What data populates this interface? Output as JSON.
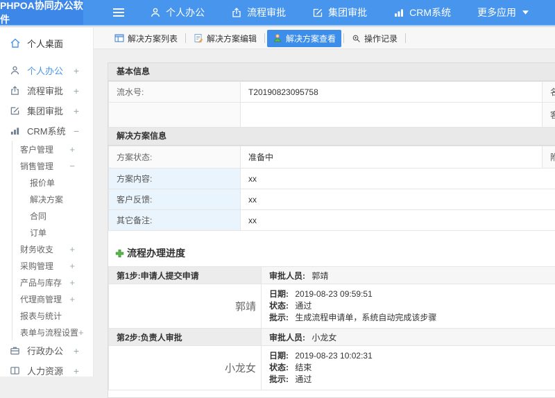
{
  "topbar": {
    "logo": "PHPOA协同办公软件",
    "nav": [
      {
        "label": "个人办公"
      },
      {
        "label": "流程审批"
      },
      {
        "label": "集团审批"
      },
      {
        "label": "CRM系统"
      },
      {
        "label": "更多应用"
      }
    ]
  },
  "sidebar": {
    "desktop": "个人桌面",
    "items": [
      {
        "label": "个人办公",
        "toggle": "+"
      },
      {
        "label": "流程审批",
        "toggle": "+"
      },
      {
        "label": "集团审批",
        "toggle": "+"
      },
      {
        "label": "CRM系统",
        "toggle": "−"
      },
      {
        "label": "客户管理",
        "toggle": "+"
      },
      {
        "label": "销售管理",
        "toggle": "−"
      },
      {
        "label": "报价单",
        "toggle": ""
      },
      {
        "label": "解决方案",
        "toggle": ""
      },
      {
        "label": "合同",
        "toggle": ""
      },
      {
        "label": "订单",
        "toggle": ""
      },
      {
        "label": "财务收支",
        "toggle": "+"
      },
      {
        "label": "采购管理",
        "toggle": "+"
      },
      {
        "label": "产品与库存",
        "toggle": "+"
      },
      {
        "label": "代理商管理",
        "toggle": "+"
      },
      {
        "label": "报表与统计",
        "toggle": ""
      },
      {
        "label": "表单与流程设置",
        "toggle": "+"
      },
      {
        "label": "行政办公",
        "toggle": "+"
      },
      {
        "label": "人力资源",
        "toggle": "+"
      }
    ]
  },
  "tabs": [
    {
      "label": "解决方案列表"
    },
    {
      "label": "解决方案编辑"
    },
    {
      "label": "解决方案查看"
    },
    {
      "label": "操作记录"
    }
  ],
  "basic": {
    "title": "基本信息",
    "serial_label": "流水号:",
    "serial": "T20190823095758",
    "name_label": "名称",
    "customer_label": "客户"
  },
  "solution": {
    "title": "解决方案信息",
    "status_label": "方案状态:",
    "status": "准备中",
    "attachment_label": "附件",
    "content_label": "方案内容:",
    "content": "xx",
    "feedback_label": "客户反馈:",
    "feedback": "xx",
    "remark_label": "其它备注:",
    "remark": "xx"
  },
  "progress": {
    "title": "流程办理进度",
    "approver_label": "审批人员:",
    "date_label": "日期:",
    "status_label": "状态:",
    "remark_label": "批示:",
    "steps": [
      {
        "step": "第1步:申请人提交申请",
        "approver": "郭靖",
        "name": "郭靖",
        "date": "2019-08-23 09:59:51",
        "status": "通过",
        "remark": "生成流程申请单，系统自动完成该步骤"
      },
      {
        "step": "第2步:负责人审批",
        "approver": "小龙女",
        "name": "小龙女",
        "date": "2019-08-23 10:02:31",
        "status": "结束",
        "remark": "通过"
      }
    ]
  },
  "colors": {
    "topbar": "#4795EC",
    "logo_bg": "#3C87E8",
    "active_tab": "#3D8EEB",
    "accent": "#4796EC",
    "plus_green": "#57B847"
  }
}
